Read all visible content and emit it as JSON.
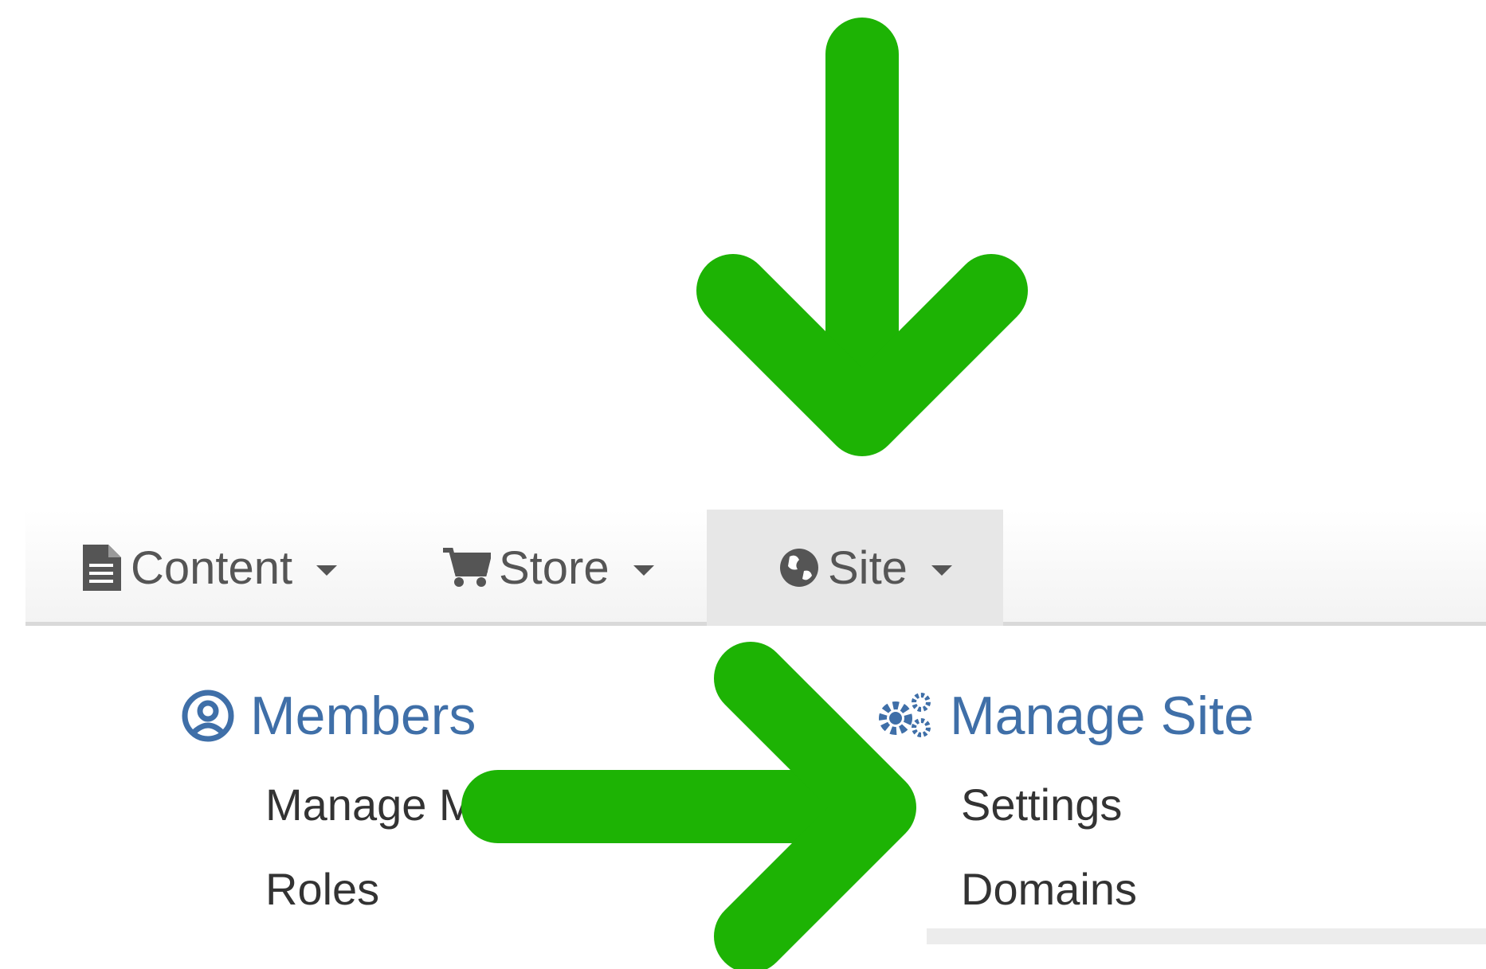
{
  "nav": {
    "items": [
      {
        "label": "Content",
        "icon": "document-icon"
      },
      {
        "label": "Store",
        "icon": "cart-icon"
      },
      {
        "label": "Site",
        "icon": "globe-icon",
        "active": true
      }
    ]
  },
  "dropdown": {
    "members": {
      "title": "Members",
      "icon": "user-circle-icon",
      "links": [
        "Manage Members",
        "Roles"
      ]
    },
    "manage_site": {
      "title": "Manage Site",
      "icon": "gears-icon",
      "links": [
        "Settings",
        "Domains"
      ]
    }
  },
  "annotations": {
    "arrow_color": "#1db304",
    "arrows": [
      "down-arrow-icon",
      "right-arrow-icon"
    ]
  },
  "colors": {
    "link_heading": "#3f6fa8",
    "nav_text": "#555555",
    "active_tab_bg": "#e7e7e7"
  }
}
